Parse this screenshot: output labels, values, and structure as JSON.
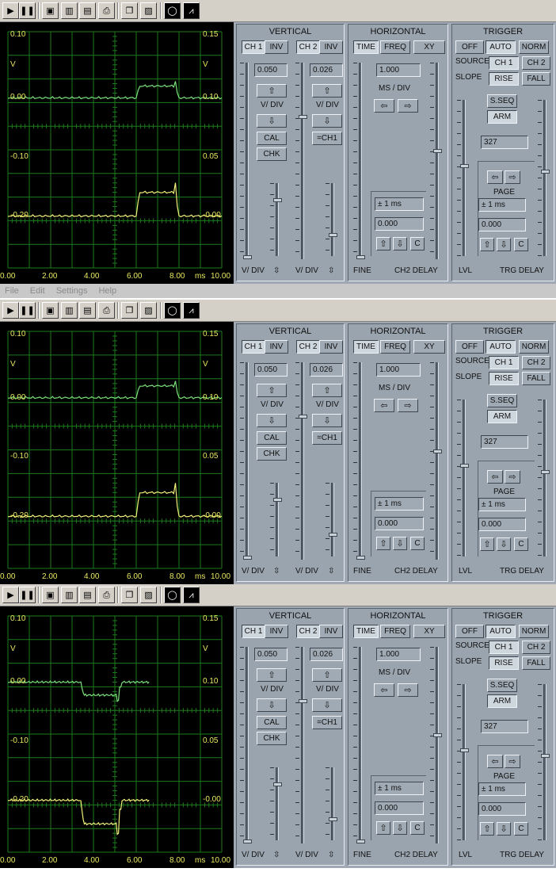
{
  "toolbar": {
    "buttons": [
      "play-icon",
      "pause-icon",
      "save-icon",
      "chart-icon",
      "table-icon",
      "print-icon",
      "copy-icon",
      "paste-image-icon",
      "lissajous-icon",
      "spectrum-icon"
    ]
  },
  "menu": {
    "file": "File",
    "edit": "Edit",
    "settings": "Settings",
    "help": "Help"
  },
  "colors": {
    "scope_bg": "#000000",
    "grid": "#1d7a1d",
    "trace_ch1": "#7be07b",
    "trace_ch2": "#f0f07a",
    "axis_text": "#e8e860",
    "panel": "#a0a9b3"
  },
  "panels": [
    {
      "scope": {
        "left_labels": [
          "0.10",
          "V",
          "0.00",
          "-0.10",
          "-0.20"
        ],
        "right_labels": [
          "0.15",
          "V",
          "0.10",
          "0.05",
          "-0.00"
        ],
        "x_labels": [
          "0.00",
          "2.00",
          "4.00",
          "6.00",
          "8.00",
          "ms",
          "10.00"
        ]
      },
      "vertical": {
        "title": "VERTICAL",
        "ch1": "CH 1",
        "inv1": "INV",
        "ch2": "CH 2",
        "inv2": "INV",
        "val1": "0.050",
        "val2": "0.026",
        "vdiv": "V/ DIV",
        "cal": "CAL",
        "chk": "CHK",
        "eqch1": "=CH1",
        "bottom1": "V/ DIV",
        "bottom2": "V/ DIV"
      },
      "horizontal": {
        "title": "HORIZONTAL",
        "time": "TIME",
        "freq": "FREQ",
        "xy": "XY",
        "val": "1.000",
        "msdiv": "MS / DIV",
        "range": "± 1 ms",
        "delay": "0.000",
        "c": "C",
        "fine": "FINE",
        "ch2delay": "CH2 DELAY"
      },
      "trigger": {
        "title": "TRIGGER",
        "off": "OFF",
        "auto": "AUTO",
        "norm": "NORM",
        "source": "SOURCE",
        "ch1": "CH 1",
        "ch2": "CH 2",
        "slope": "SLOPE",
        "rise": "RISE",
        "fall": "FALL",
        "sseq": "S.SEQ",
        "arm": "ARM",
        "level": "327",
        "page": "PAGE",
        "range": "± 1 ms",
        "delay": "0.000",
        "c": "C",
        "lvl": "LVL",
        "trgdelay": "TRG DELAY"
      }
    },
    {
      "scope": {
        "left_labels": [
          "0.10",
          "V",
          "0.00",
          "-0.10",
          "-0.20"
        ],
        "right_labels": [
          "0.15",
          "V",
          "0.10",
          "0.05",
          "-0.00"
        ],
        "x_labels": [
          "0.00",
          "2.00",
          "4.00",
          "6.00",
          "8.00",
          "ms",
          "10.00"
        ]
      },
      "vertical": {
        "title": "VERTICAL",
        "ch1": "CH 1",
        "inv1": "INV",
        "ch2": "CH 2",
        "inv2": "INV",
        "val1": "0.050",
        "val2": "0.026",
        "vdiv": "V/ DIV",
        "cal": "CAL",
        "chk": "CHK",
        "eqch1": "=CH1",
        "bottom1": "V/ DIV",
        "bottom2": "V/ DIV"
      },
      "horizontal": {
        "title": "HORIZONTAL",
        "time": "TIME",
        "freq": "FREQ",
        "xy": "XY",
        "val": "1.000",
        "msdiv": "MS / DIV",
        "range": "± 1 ms",
        "delay": "0.000",
        "c": "C",
        "fine": "FINE",
        "ch2delay": "CH2 DELAY"
      },
      "trigger": {
        "title": "TRIGGER",
        "off": "OFF",
        "auto": "AUTO",
        "norm": "NORM",
        "source": "SOURCE",
        "ch1": "CH 1",
        "ch2": "CH 2",
        "slope": "SLOPE",
        "rise": "RISE",
        "fall": "FALL",
        "sseq": "S.SEQ",
        "arm": "ARM",
        "level": "327",
        "page": "PAGE",
        "range": "± 1 ms",
        "delay": "0.000",
        "c": "C",
        "lvl": "LVL",
        "trgdelay": "TRG DELAY"
      }
    },
    {
      "scope": {
        "left_labels": [
          "0.10",
          "V",
          "0.00",
          "-0.10",
          "-0.20"
        ],
        "right_labels": [
          "0.15",
          "V",
          "0.10",
          "0.05",
          "-0.00"
        ],
        "x_labels": [
          "0.00",
          "2.00",
          "4.00",
          "6.00",
          "8.00",
          "ms",
          "10.00"
        ]
      },
      "vertical": {
        "title": "VERTICAL",
        "ch1": "CH 1",
        "inv1": "INV",
        "ch2": "CH 2",
        "inv2": "INV",
        "val1": "0.050",
        "val2": "0.026",
        "vdiv": "V/ DIV",
        "cal": "CAL",
        "chk": "CHK",
        "eqch1": "=CH1",
        "bottom1": "V/ DIV",
        "bottom2": "V/ DIV"
      },
      "horizontal": {
        "title": "HORIZONTAL",
        "time": "TIME",
        "freq": "FREQ",
        "xy": "XY",
        "val": "1.000",
        "msdiv": "MS / DIV",
        "range": "± 1 ms",
        "delay": "0.000",
        "c": "C",
        "fine": "FINE",
        "ch2delay": "CH2 DELAY"
      },
      "trigger": {
        "title": "TRIGGER",
        "off": "OFF",
        "auto": "AUTO",
        "norm": "NORM",
        "source": "SOURCE",
        "ch1": "CH 1",
        "ch2": "CH 2",
        "slope": "SLOPE",
        "rise": "RISE",
        "fall": "FALL",
        "sseq": "S.SEQ",
        "arm": "ARM",
        "level": "327",
        "page": "PAGE",
        "range": "± 1 ms",
        "delay": "0.000",
        "c": "C",
        "lvl": "LVL",
        "trgdelay": "TRG DELAY"
      }
    }
  ]
}
